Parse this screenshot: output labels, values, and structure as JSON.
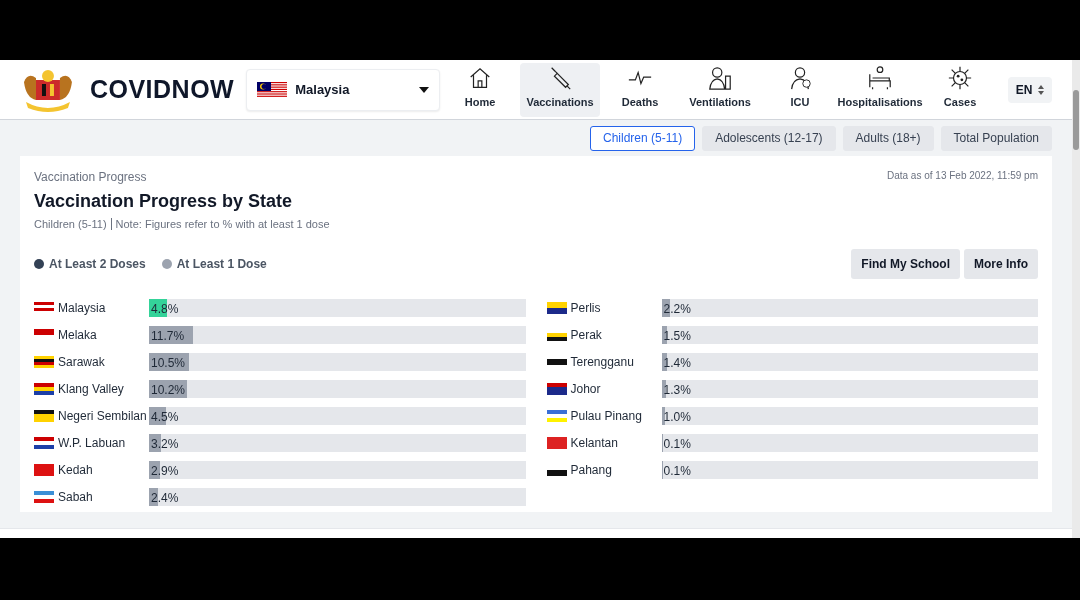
{
  "header": {
    "brand": "COVIDNOW",
    "country_select": {
      "value": "Malaysia"
    },
    "nav": [
      {
        "label": "Home",
        "selected": false
      },
      {
        "label": "Vaccinations",
        "selected": true
      },
      {
        "label": "Deaths",
        "selected": false
      },
      {
        "label": "Ventilations",
        "selected": false
      },
      {
        "label": "ICU",
        "selected": false
      },
      {
        "label": "Hospitalisations",
        "selected": false
      },
      {
        "label": "Cases",
        "selected": false
      }
    ],
    "language": "EN"
  },
  "groups": [
    {
      "label": "Children (5-11)",
      "selected": true
    },
    {
      "label": "Adolescents (12-17)",
      "selected": false
    },
    {
      "label": "Adults (18+)",
      "selected": false
    },
    {
      "label": "Total Population",
      "selected": false
    }
  ],
  "card": {
    "eyebrow": "Vaccination Progress",
    "title": "Vaccination Progress by State",
    "subtitle": "Children (5-11)",
    "note": "Note: Figures refer to % with at least 1 dose",
    "updated": "Data as of 13 Feb 2022, 11:59 pm",
    "legend": [
      {
        "label": "At Least 2 Doses",
        "color": "#334155"
      },
      {
        "label": "At Least 1 Dose",
        "color": "#9ca3af"
      }
    ],
    "buttons": [
      "Find My School",
      "More Info"
    ],
    "states_left": [
      {
        "name": "Malaysia",
        "value": "4.8%",
        "level": 0.048,
        "color": "#34d399"
      },
      {
        "name": "Melaka",
        "value": "11.7%",
        "level": 0.117,
        "color": "#9ca3af"
      },
      {
        "name": "Sarawak",
        "value": "10.5%",
        "level": 0.105,
        "color": "#9ca3af"
      },
      {
        "name": "Klang Valley",
        "value": "10.2%",
        "level": 0.102,
        "color": "#9ca3af"
      },
      {
        "name": "Negeri Sembilan",
        "value": "4.5%",
        "level": 0.045,
        "color": "#9ca3af"
      },
      {
        "name": "W.P. Labuan",
        "value": "3.2%",
        "level": 0.032,
        "color": "#9ca3af"
      },
      {
        "name": "Kedah",
        "value": "2.9%",
        "level": 0.029,
        "color": "#9ca3af"
      },
      {
        "name": "Sabah",
        "value": "2.4%",
        "level": 0.024,
        "color": "#9ca3af"
      }
    ],
    "states_right": [
      {
        "name": "Perlis",
        "value": "2.2%",
        "level": 0.022,
        "color": "#9ca3af"
      },
      {
        "name": "Perak",
        "value": "1.5%",
        "level": 0.015,
        "color": "#9ca3af"
      },
      {
        "name": "Terengganu",
        "value": "1.4%",
        "level": 0.014,
        "color": "#9ca3af"
      },
      {
        "name": "Johor",
        "value": "1.3%",
        "level": 0.013,
        "color": "#9ca3af"
      },
      {
        "name": "Pulau Pinang",
        "value": "1.0%",
        "level": 0.01,
        "color": "#9ca3af"
      },
      {
        "name": "Kelantan",
        "value": "0.1%",
        "level": 0.001,
        "color": "#9ca3af"
      },
      {
        "name": "Pahang",
        "value": "0.1%",
        "level": 0.001,
        "color": "#9ca3af"
      }
    ]
  }
}
